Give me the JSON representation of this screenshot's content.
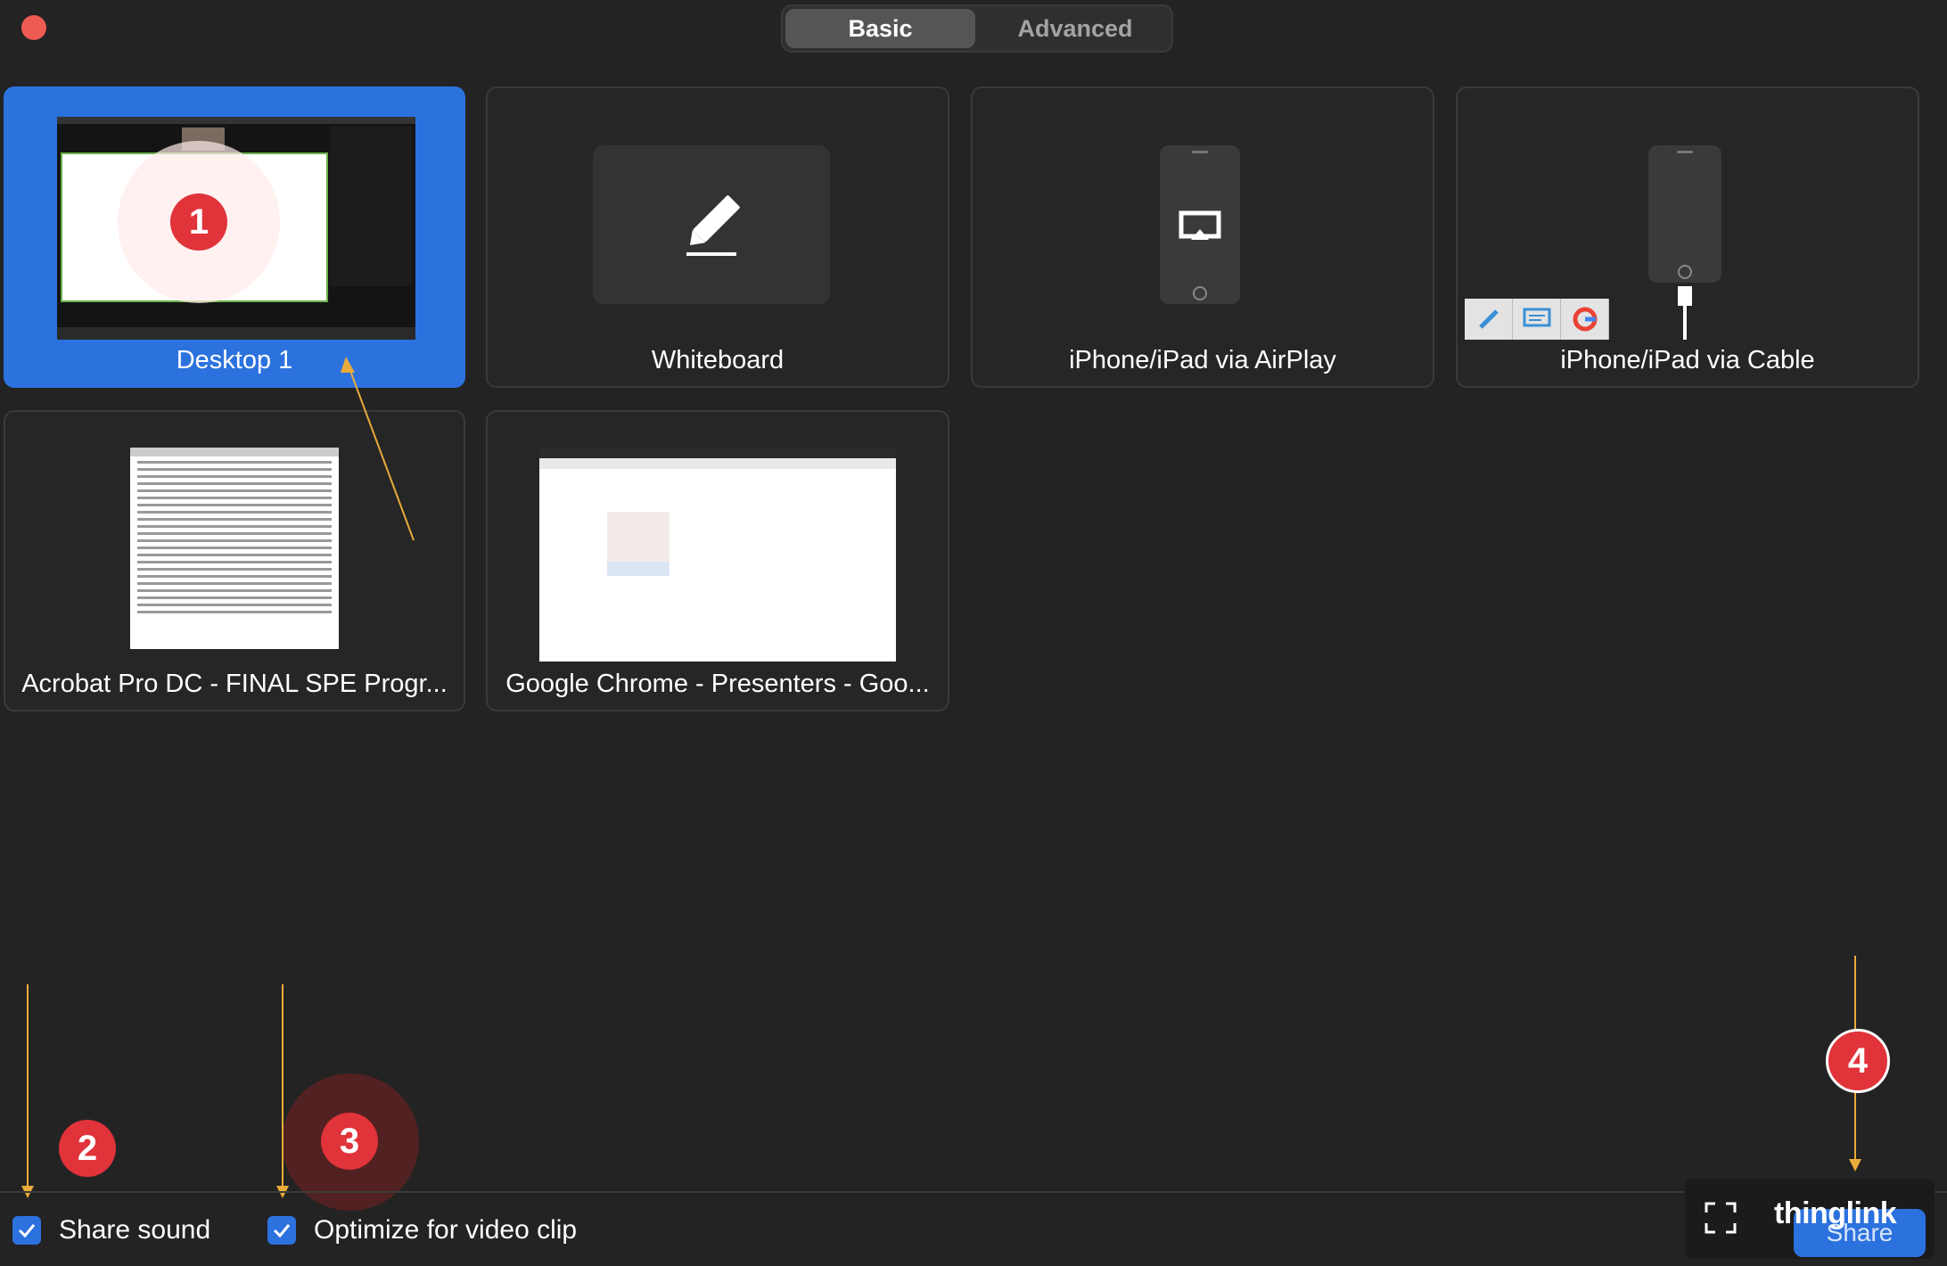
{
  "window": {
    "close_icon": "close-icon"
  },
  "tabs": [
    {
      "label": "Basic",
      "active": true
    },
    {
      "label": "Advanced",
      "active": false
    }
  ],
  "sources": [
    {
      "label": "Desktop 1",
      "selected": true,
      "icon": "desktop-preview"
    },
    {
      "label": "Whiteboard",
      "selected": false,
      "icon": "pencil-icon"
    },
    {
      "label": "iPhone/iPad via AirPlay",
      "selected": false,
      "icon": "airplay-icon"
    },
    {
      "label": "iPhone/iPad via Cable",
      "selected": false,
      "icon": "phone-cable-icon"
    },
    {
      "label": "Acrobat Pro DC - FINAL SPE Progr...",
      "selected": false,
      "icon": "acrobat-window-preview"
    },
    {
      "label": "Google Chrome - Presenters - Goo...",
      "selected": false,
      "icon": "chrome-window-preview"
    }
  ],
  "options": {
    "share_sound": {
      "label": "Share sound",
      "checked": true
    },
    "optimize_video": {
      "label": "Optimize for video clip",
      "checked": true
    }
  },
  "footer": {
    "share_label": "Share",
    "brand": "thinglink",
    "fullscreen_icon": "fullscreen-icon"
  },
  "annotations": {
    "badge1": "1",
    "badge2": "2",
    "badge3": "3",
    "badge4": "4"
  },
  "colors": {
    "accent": "#2c72de",
    "background": "#232323",
    "badge": "#e1333a",
    "arrow": "#e9ab3a",
    "close": "#ee5b53"
  }
}
